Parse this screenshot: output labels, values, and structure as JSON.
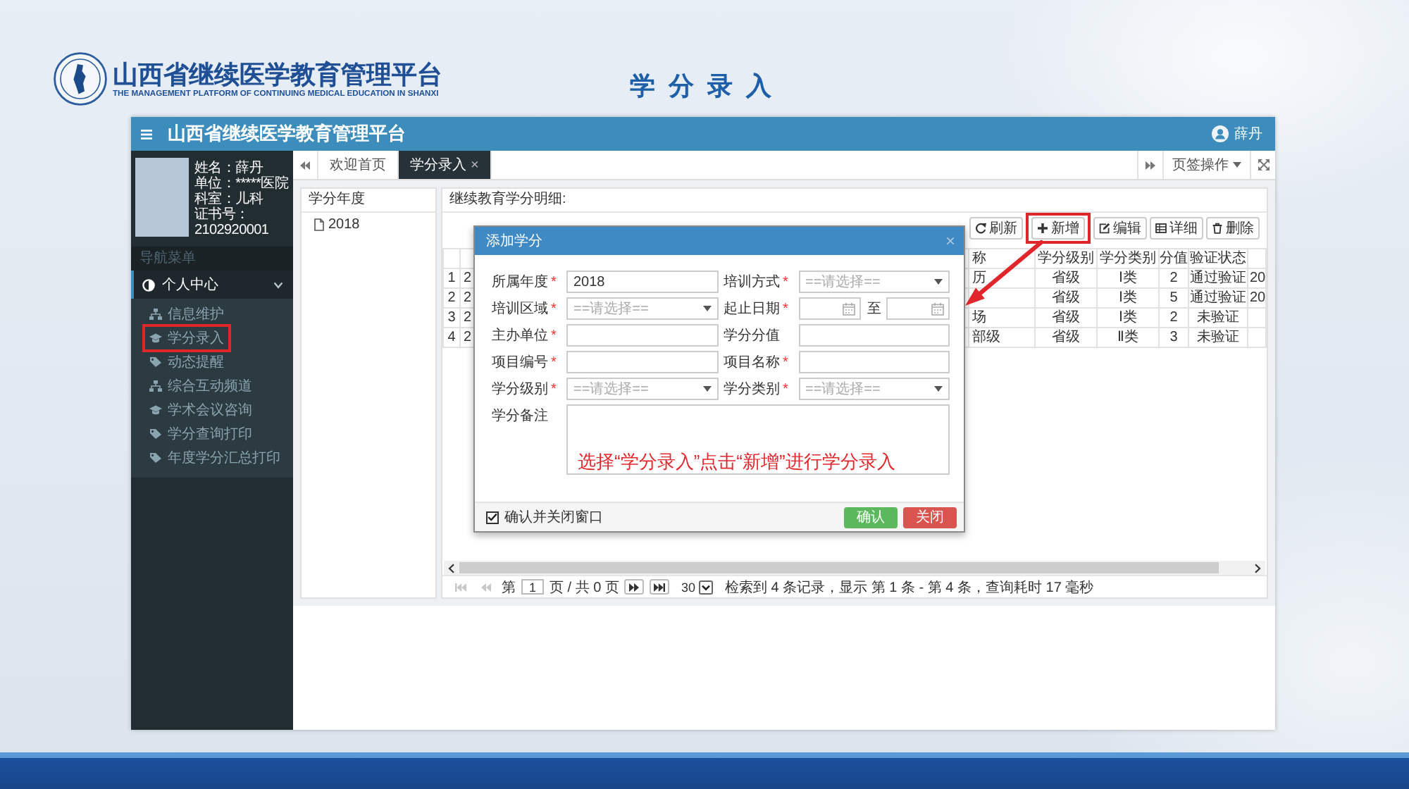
{
  "slide": {
    "emblem_title": "山西省继续医学教育管理平台",
    "emblem_subtitle": "THE MANAGEMENT PLATFORM OF CONTINUING MEDICAL EDUCATION IN SHANXI",
    "page_title": "学分录入"
  },
  "app": {
    "title": "山西省继续医学教育管理平台",
    "user": "薛丹"
  },
  "profile": [
    "姓名：薛丹",
    "单位：*****医院",
    "科室：儿科",
    "证书号：",
    "2102920001"
  ],
  "sidebar": {
    "heading": "导航菜单",
    "items": [
      {
        "label": "个人中心",
        "expanded": true,
        "children": [
          {
            "label": "信息维护",
            "highlighted": false
          },
          {
            "label": "学分录入",
            "highlighted": true
          },
          {
            "label": "动态提醒",
            "highlighted": false
          },
          {
            "label": "综合互动频道",
            "highlighted": false
          },
          {
            "label": "学术会议咨询",
            "highlighted": false
          },
          {
            "label": "学分查询打印",
            "highlighted": false
          },
          {
            "label": "年度学分汇总打印",
            "highlighted": false
          }
        ]
      }
    ]
  },
  "tabs": [
    {
      "label": "欢迎首页",
      "selected": false
    },
    {
      "label": "学分录入",
      "selected": true,
      "close": "×"
    }
  ],
  "tab_menu": "页签操作",
  "year_panel": {
    "title": "学分年度",
    "items": [
      "2018"
    ]
  },
  "detail_panel": {
    "title": "继续教育学分明细:",
    "toolbar": [
      {
        "label": "刷新",
        "highlighted": false
      },
      {
        "label": "新增",
        "highlighted": true
      },
      {
        "label": "编辑",
        "highlighted": false
      },
      {
        "label": "详细",
        "highlighted": false
      },
      {
        "label": "删除",
        "highlighted": false
      }
    ],
    "table": {
      "headers": {
        "column_3": "称",
        "level": "学分级别",
        "category": "学分类别",
        "score": "分值",
        "status": "验证状态"
      },
      "rows": [
        {
          "index": "1",
          "column_2": "2",
          "column_3": "历",
          "level": "省级",
          "category": "Ⅰ类",
          "score": "2",
          "status": "通过验证",
          "column_8": "20"
        },
        {
          "index": "2",
          "column_2": "2",
          "level": "省级",
          "category": "Ⅰ类",
          "score": "5",
          "status": "通过验证",
          "column_8": "20"
        },
        {
          "index": "3",
          "column_2": "2",
          "column_3": "场",
          "level": "省级",
          "category": "Ⅰ类",
          "score": "2",
          "status": "未验证"
        },
        {
          "index": "4",
          "column_2": "2",
          "column_3": "部级",
          "level": "省级",
          "category": "Ⅱ类",
          "score": "3",
          "status": "未验证"
        }
      ]
    },
    "pager": {
      "back": [
        {
          "disabled": true
        },
        {
          "disabled": true
        }
      ],
      "page_prefix": "第",
      "page": "1",
      "page_suffix": "页 / 共 0 页",
      "forward": [
        {
          "disabled": false
        },
        {
          "disabled": false
        }
      ],
      "page_size": "30",
      "info": "检索到 4 条记录，显示 第 1 条 - 第 4 条，查询耗时 17 毫秒"
    }
  },
  "dialog": {
    "title": "添加学分",
    "close": "×",
    "fields": [
      {
        "label": "所属年度",
        "mark": "*",
        "kind": "text",
        "value": "2018"
      },
      {
        "label": "培训方式",
        "mark": "*",
        "kind": "select",
        "placeholder": "==请选择=="
      },
      {
        "label": "培训区域",
        "mark": "*",
        "kind": "select",
        "placeholder": "==请选择=="
      },
      {
        "label": "起止日期",
        "mark": "*",
        "kind": "date_range",
        "separator": "至"
      },
      {
        "label": "主办单位",
        "mark": "*",
        "kind": "text"
      },
      {
        "label": "学分分值",
        "kind": "text"
      },
      {
        "label": "项目编号",
        "mark": "*",
        "kind": "text"
      },
      {
        "label": "项目名称",
        "mark": "*",
        "kind": "text"
      },
      {
        "label": "学分级别",
        "mark": "*",
        "kind": "select",
        "placeholder": "==请选择=="
      },
      {
        "label": "学分类别",
        "mark": "*",
        "kind": "select",
        "placeholder": "==请选择=="
      },
      {
        "label": "学分备注",
        "kind": "textarea"
      }
    ],
    "confirm_close": {
      "label": "确认并关闭窗口",
      "checked": true
    },
    "buttons": [
      {
        "label": "确认",
        "kind": "confirm"
      },
      {
        "label": "关闭",
        "kind": "danger"
      }
    ]
  },
  "annotation": {
    "note": "选择“学分录入”点击“新增”进行学分录入"
  }
}
